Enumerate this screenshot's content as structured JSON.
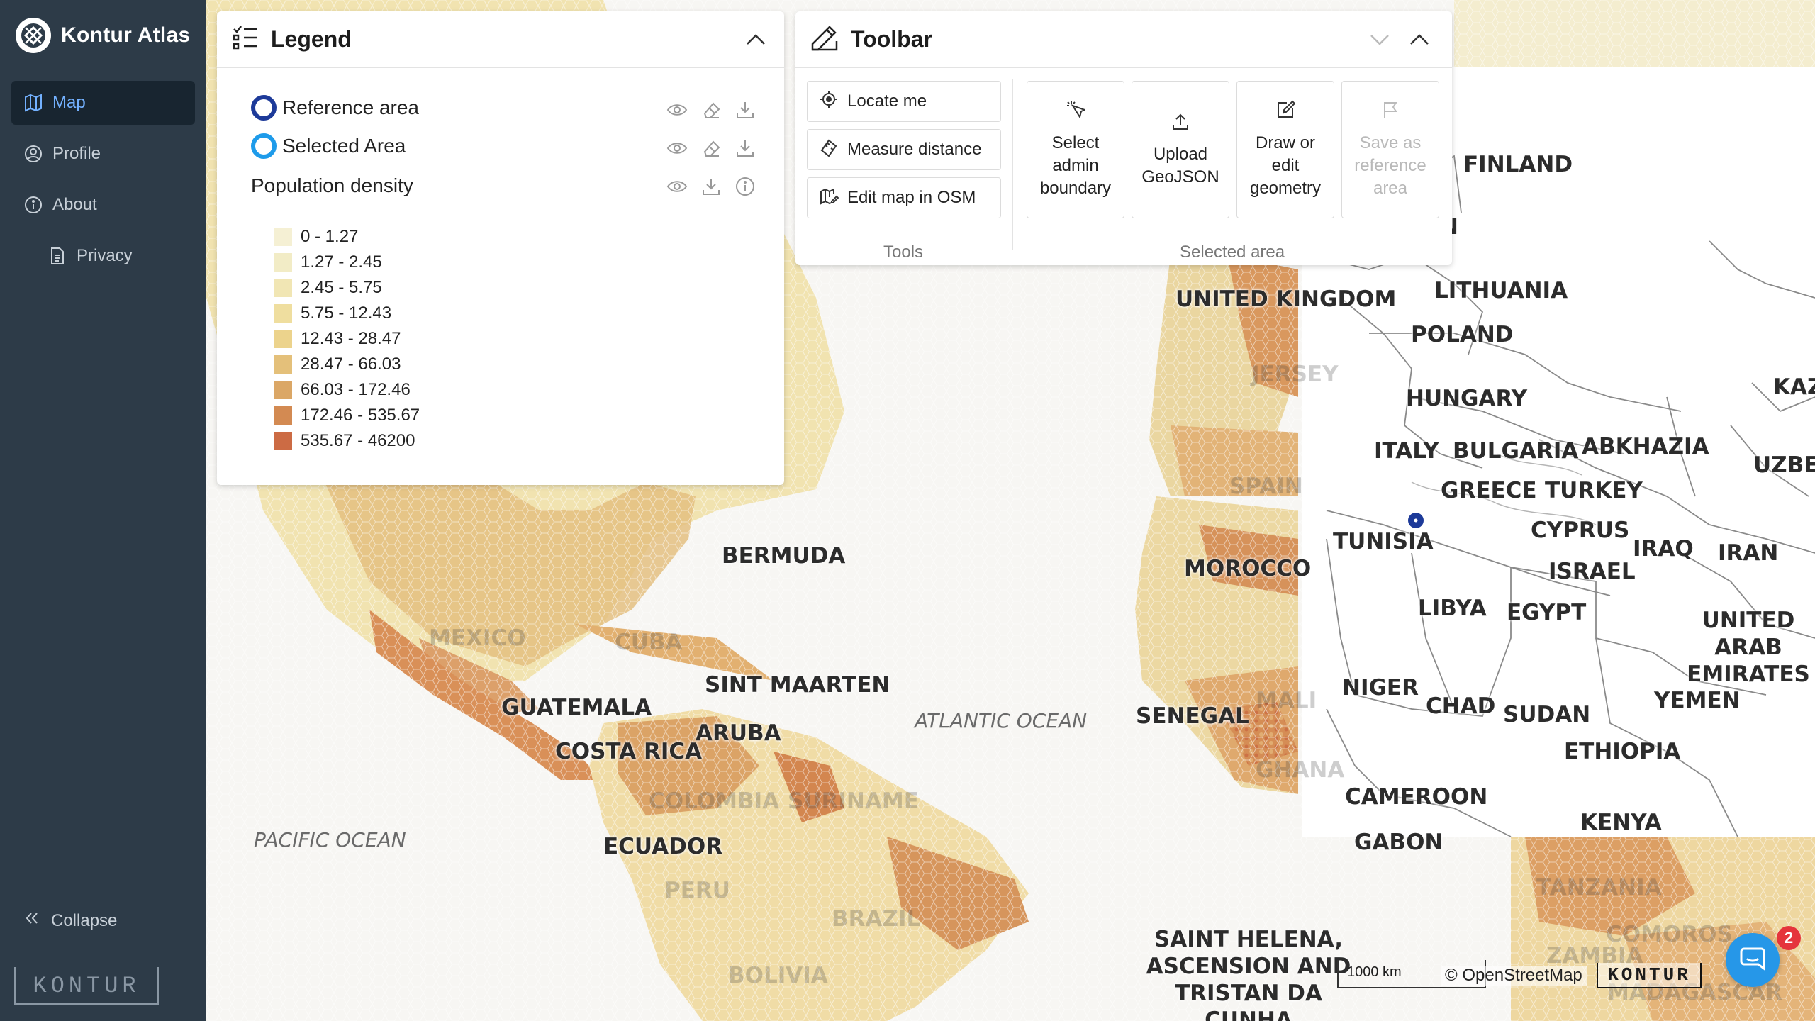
{
  "app": {
    "name": "Kontur Atlas"
  },
  "sidebar": {
    "items": [
      {
        "label": "Map",
        "icon": "map-icon",
        "active": true
      },
      {
        "label": "Profile",
        "icon": "profile-icon",
        "active": false
      },
      {
        "label": "About",
        "icon": "info-icon",
        "active": false
      },
      {
        "label": "Privacy",
        "icon": "document-icon",
        "active": false
      }
    ],
    "collapse_label": "Collapse",
    "footer_logo": "KONTUR"
  },
  "legend": {
    "title": "Legend",
    "layers": [
      {
        "label": "Reference area",
        "ring_color": "#1d3a99"
      },
      {
        "label": "Selected Area",
        "ring_color": "#1e9bea"
      },
      {
        "label": "Population density"
      }
    ],
    "bins": [
      {
        "label": "0 - 1.27",
        "color": "#f5f0d4"
      },
      {
        "label": "1.27 - 2.45",
        "color": "#f2ecc6"
      },
      {
        "label": "2.45 - 5.75",
        "color": "#f1e6b4"
      },
      {
        "label": "5.75 - 12.43",
        "color": "#efde9f"
      },
      {
        "label": "12.43 - 28.47",
        "color": "#ecd38c"
      },
      {
        "label": "28.47 - 66.03",
        "color": "#e4c07a"
      },
      {
        "label": "66.03 - 172.46",
        "color": "#dba766"
      },
      {
        "label": "172.46 - 535.67",
        "color": "#d38a52"
      },
      {
        "label": "535.67 - 46200",
        "color": "#cc6b44"
      }
    ]
  },
  "toolbar": {
    "title": "Toolbar",
    "tools": [
      {
        "label": "Locate me",
        "icon": "locate-icon"
      },
      {
        "label": "Measure distance",
        "icon": "ruler-icon"
      },
      {
        "label": "Edit map in OSM",
        "icon": "edit-map-icon"
      }
    ],
    "tools_section_label": "Tools",
    "selected_area_buttons": [
      {
        "label": "Select admin boundary",
        "icon": "cursor-icon",
        "enabled": true
      },
      {
        "label": "Upload GeoJSON",
        "icon": "upload-icon",
        "enabled": true
      },
      {
        "label": "Draw or edit geometry",
        "icon": "draw-icon",
        "enabled": true
      },
      {
        "label": "Save as reference area",
        "icon": "flag-icon",
        "enabled": false
      }
    ],
    "selected_area_section_label": "Selected area"
  },
  "map": {
    "ocean_labels": [
      "ATLANTIC OCEAN",
      "PACIFIC OCEAN"
    ],
    "country_labels": [
      "FINLAND",
      "UNITED KINGDOM",
      "LITHUANIA",
      "POLAND",
      "JERSEY",
      "HUNGARY",
      "KAZ",
      "ITALY",
      "BULGARIA",
      "ABKHAZIA",
      "UZBEK",
      "GREECE",
      "TURKEY",
      "SPAIN",
      "TUNISIA",
      "CYPRUS",
      "IRAQ",
      "IRAN",
      "MOROCCO",
      "ISRAEL",
      "BERMUDA",
      "LIBYA",
      "EGYPT",
      "UNITED ARAB EMIRATES",
      "MEXICO",
      "CUBA",
      "SINT MAARTEN",
      "NIGER",
      "CHAD",
      "YEMEN",
      "SENEGAL",
      "MALI",
      "SUDAN",
      "GUATEMALA",
      "ARUBA",
      "COSTA RICA",
      "ETHIOPIA",
      "GHANA",
      "CAMEROON",
      "COLOMBIA",
      "SURINAME",
      "KENYA",
      "ECUADOR",
      "GABON",
      "PERU",
      "TANZANIA",
      "BRAZIL",
      "SAINT HELENA, ASCENSION AND TRISTAN DA CUNHA",
      "ZAMBIA",
      "COMOROS",
      "BOLIVIA",
      "MADAGASCAR",
      "N"
    ],
    "scale_label": "1000 km",
    "attribution": "© OpenStreetMap",
    "brand": "KONTUR",
    "chat_badge_count": "2"
  }
}
